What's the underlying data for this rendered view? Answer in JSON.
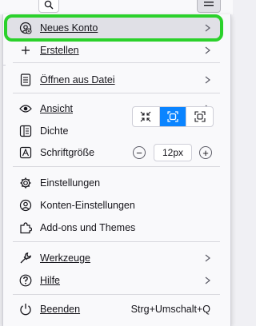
{
  "toolbar": {
    "search_icon": "search-icon",
    "menu_icon": "hamburger-menu-icon"
  },
  "menu": {
    "new_account": "Neues Konto",
    "create": "Erstellen",
    "open_file": "Öffnen aus Datei",
    "view": "Ansicht",
    "density": "Dichte",
    "font_size": "Schriftgröße",
    "font_size_value": "12px",
    "settings": "Einstellungen",
    "account_settings": "Konten-Einstellungen",
    "addons": "Add-ons und Themes",
    "tools": "Werkzeuge",
    "help": "Hilfe",
    "quit": "Beenden",
    "quit_shortcut": "Strg+Umschalt+Q",
    "decrease": "−",
    "increase": "+"
  },
  "colors": {
    "highlight_outline": "#2bd12b",
    "selected_density": "#0a84ff",
    "panel_bg": "#f9f9fb"
  }
}
